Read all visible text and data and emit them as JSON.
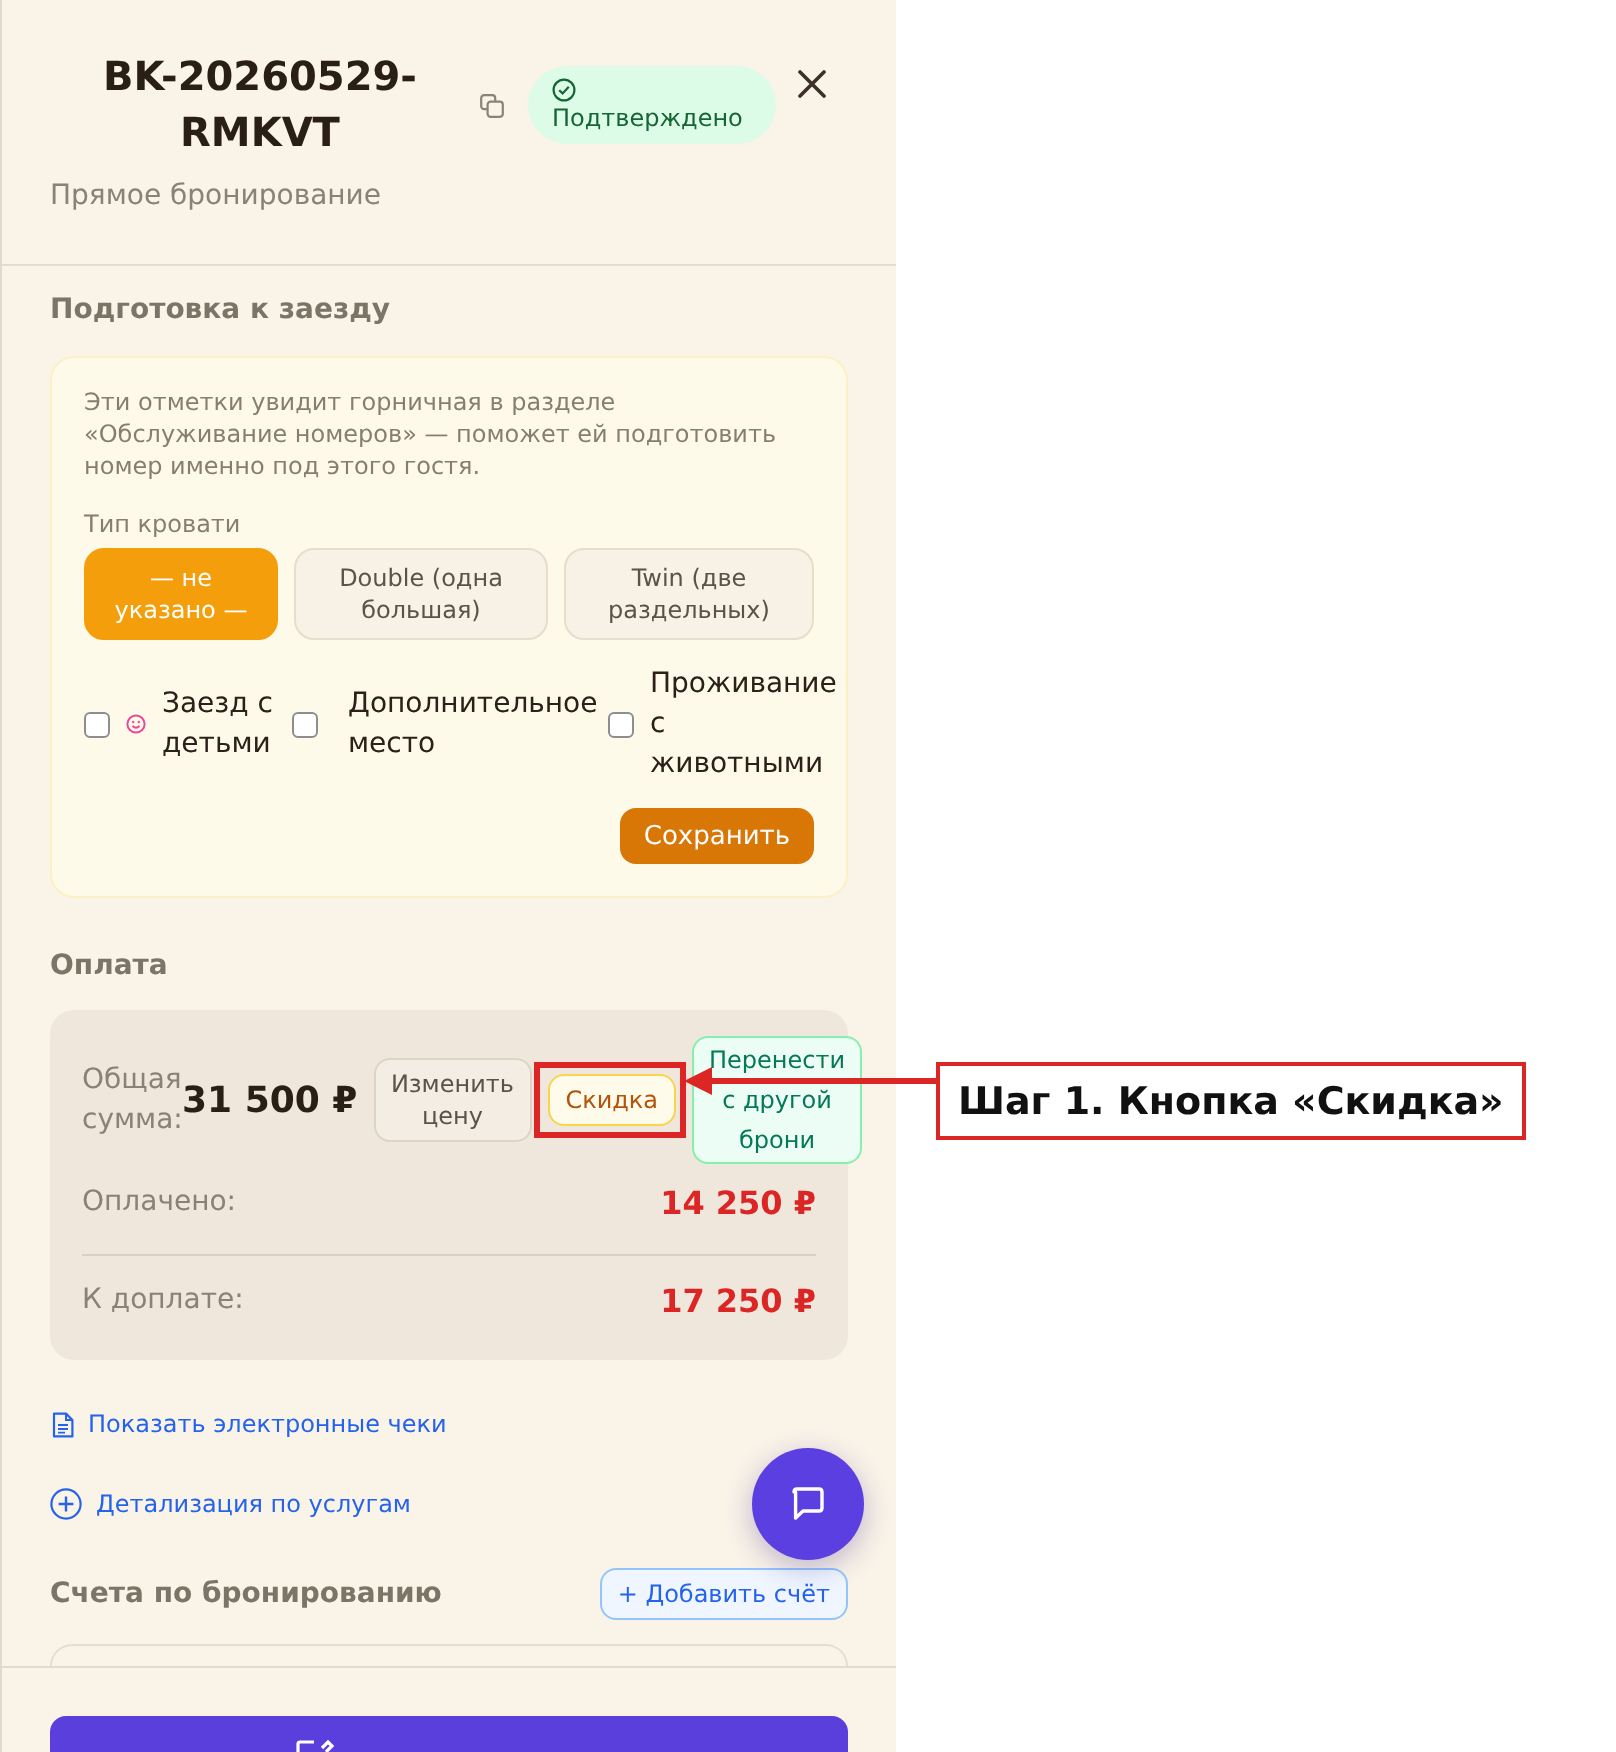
{
  "booking": {
    "title": "BK-20260529-RMKVT",
    "status": {
      "label": "Подтверждено",
      "kind": "confirmed"
    },
    "source": "Прямое бронирование"
  },
  "checkin_prep": {
    "title": "Подготовка к заезду",
    "note": "Эти отметки увидит горничная в разделе «Обслуживание номеров» — поможет ей подготовить номер именно под этого гостя.",
    "bed_type_label": "Тип кровати",
    "bed_types": [
      {
        "label": "— не указано —",
        "selected": true
      },
      {
        "label": "Double (одна большая)",
        "selected": false
      },
      {
        "label": "Twin (две раздельных)",
        "selected": false
      }
    ],
    "options": [
      {
        "label": "Заезд с детьми",
        "checked": false,
        "kind": "icon"
      },
      {
        "label": "Дополнительное место",
        "checked": false,
        "kind": "plain"
      },
      {
        "label": "Проживание с животными",
        "checked": false,
        "kind": "plain"
      }
    ],
    "save_button": "Сохранить"
  },
  "payment": {
    "title": "Оплата",
    "total_label": "Общая сумма:",
    "total": "31 500 ₽",
    "actions": [
      {
        "label": "Изменить цену",
        "kind": "neutral",
        "highlighted": false
      },
      {
        "label": "Скидка",
        "kind": "discount",
        "highlighted": true
      },
      {
        "label": "Перенести с другой брони",
        "kind": "transfer",
        "highlighted": false
      }
    ],
    "rows": [
      {
        "label": "Оплачено:",
        "value": "14 250 ₽"
      },
      {
        "label": "К доплате:",
        "value": "17 250 ₽"
      }
    ]
  },
  "links": [
    {
      "label": "Показать электронные чеки",
      "kind": "receipts"
    },
    {
      "label": "Детализация по услугам",
      "kind": "details"
    }
  ],
  "invoices": {
    "title": "Счета по бронированию",
    "add_button": "+ Добавить счёт"
  },
  "annotation": {
    "label": "Шаг 1. Кнопка «Скидка»"
  }
}
